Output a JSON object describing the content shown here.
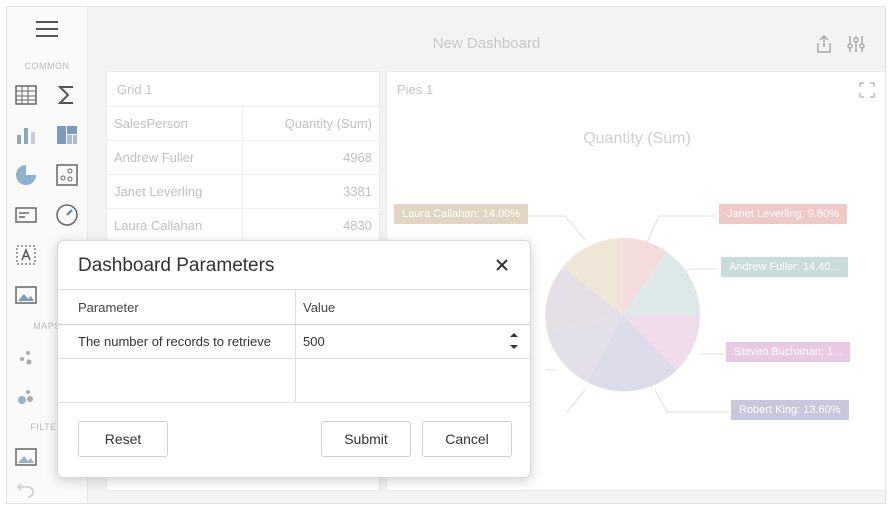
{
  "dashboard": {
    "title": "New Dashboard"
  },
  "toolbox": {
    "groups": [
      "COMMON",
      "MAPS",
      "FILTER"
    ]
  },
  "grid": {
    "caption": "Grid 1",
    "columns": [
      "SalesPerson",
      "Quantity (Sum)"
    ],
    "rows": [
      {
        "name": "Andrew Fuller",
        "qty": "4968"
      },
      {
        "name": "Janet Leverling",
        "qty": "3381"
      },
      {
        "name": "Laura Callahan",
        "qty": "4830"
      }
    ]
  },
  "pie": {
    "caption": "Pies 1",
    "chart_title": "Quantity (Sum)",
    "labels": [
      {
        "text": "Laura Callahan: 14.00%",
        "color": "#e2d6c3"
      },
      {
        "text": "Janet Leverling: 9.80%",
        "color": "#efc8c8"
      },
      {
        "text": "Andrew Fuller: 14.40...",
        "color": "#c9dcdc"
      },
      {
        "text": "Steven Buchanan: 1...",
        "color": "#e9c9e3"
      },
      {
        "text": "Robert King: 13.60%",
        "color": "#c8c8dc"
      }
    ]
  },
  "dialog": {
    "title": "Dashboard Parameters",
    "columns": {
      "parameter": "Parameter",
      "value": "Value"
    },
    "params": [
      {
        "name": "The number of records to retrieve",
        "value": "500"
      }
    ],
    "buttons": {
      "reset": "Reset",
      "submit": "Submit",
      "cancel": "Cancel"
    }
  }
}
